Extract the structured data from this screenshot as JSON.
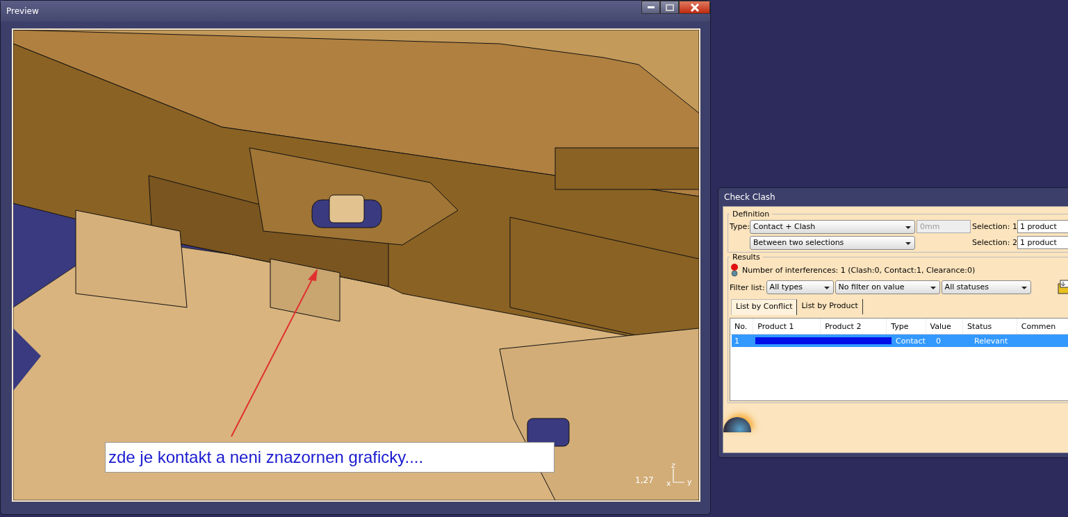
{
  "preview_window": {
    "title": "Preview",
    "annotation": "zde je kontakt a neni znazornen graficky....",
    "zoom_reading": "1,27",
    "axes": [
      "z",
      "x",
      "y"
    ]
  },
  "check_clash": {
    "title": "Check Clash",
    "definition": {
      "legend": "Definition",
      "type_label": "Type:",
      "type_value": "Contact + Clash",
      "clearance": "0mm",
      "mode_value": "Between two selections",
      "selections": [
        {
          "label": "Selection: 1",
          "value": "1 product"
        },
        {
          "label": "Selection: 2",
          "value": "1 product"
        }
      ]
    },
    "results": {
      "legend": "Results",
      "summary": "Number of interferences: 1 (Clash:0, Contact:1, Clearance:0)",
      "filter_label": "Filter list:",
      "filters": [
        "All types",
        "No filter on value",
        "All statuses"
      ],
      "tabs": [
        {
          "label": "List by Conflict",
          "selected": true
        },
        {
          "label": "List by Product",
          "selected": false
        }
      ],
      "columns": [
        "No.",
        "Product 1",
        "Product 2",
        "Type",
        "Value",
        "Status",
        "Commen"
      ],
      "rows": [
        {
          "no": "1",
          "type": "Contact",
          "value": "0",
          "status": "Relevant",
          "selected": true
        }
      ]
    }
  }
}
